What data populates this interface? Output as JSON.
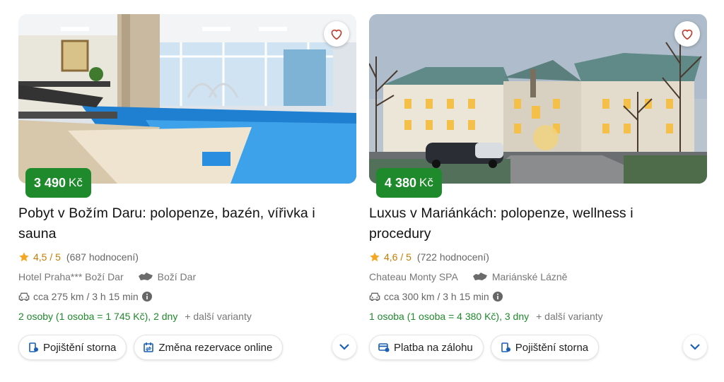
{
  "offers": [
    {
      "price": "3 490",
      "currency": "Kč",
      "title": "Pobyt v Božím Daru: polopenze, bazén, vířivka i sauna",
      "rating": "4,5 / 5",
      "reviews": "(687 hodnocení)",
      "hotel": "Hotel Praha*** Boží Dar",
      "location": "Boží Dar",
      "distance": "cca 275 km / 3 h 15 min",
      "persons": "2 osoby (1 osoba = 1 745 Kč), 2 dny",
      "more": "+ další varianty",
      "chips": [
        "Pojištění storna",
        "Změna rezervace online"
      ]
    },
    {
      "price": "4 380",
      "currency": "Kč",
      "title": "Luxus v Mariánkách: polopenze, wellness i procedury",
      "rating": "4,6 / 5",
      "reviews": "(722 hodnocení)",
      "hotel": "Chateau Monty SPA",
      "location": "Mariánské Lázně",
      "distance": "cca 300 km / 3 h 15 min",
      "persons": "1 osoba (1 osoba = 4 380 Kč), 3 dny",
      "more": "+ další varianty",
      "chips": [
        "Platba na zálohu",
        "Pojištění storna"
      ]
    }
  ],
  "colors": {
    "price_badge": "#1e8a2b",
    "star": "#f5a623",
    "accent": "#1a73e8",
    "heart": "#c0392b"
  },
  "icons": [
    "heart-icon",
    "star-icon",
    "map-icon",
    "car-icon",
    "info-icon",
    "insurance-icon",
    "calendar-change-icon",
    "payment-card-icon",
    "chevron-down-icon"
  ]
}
